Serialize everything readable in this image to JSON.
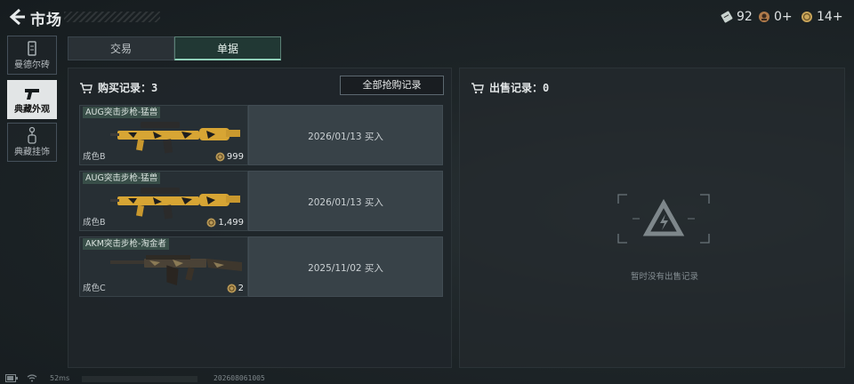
{
  "header": {
    "title": "市场",
    "currencies": [
      {
        "icon": "ticket-icon",
        "value": "92"
      },
      {
        "icon": "gold-token-icon",
        "value": "0+"
      },
      {
        "icon": "coin-icon",
        "value": "14+"
      }
    ]
  },
  "sidebar": {
    "items": [
      {
        "label": "曼德尔砖",
        "icon": "mandel-brick-icon",
        "active": false
      },
      {
        "label": "典藏外观",
        "icon": "pistol-icon",
        "active": true
      },
      {
        "label": "典藏挂饰",
        "icon": "charm-icon",
        "active": false
      }
    ]
  },
  "tabs": [
    {
      "label": "交易",
      "active": false
    },
    {
      "label": "单据",
      "active": true
    }
  ],
  "buy": {
    "title": "购买记录：",
    "count": "3",
    "all_button": "全部抢购记录",
    "records": [
      {
        "name": "AUG突击步枪-猛兽",
        "grade": "成色B",
        "price": "999",
        "record": "2026/01/13 买入",
        "weapon": "aug"
      },
      {
        "name": "AUG突击步枪-猛兽",
        "grade": "成色B",
        "price": "1,499",
        "record": "2026/01/13 买入",
        "weapon": "aug"
      },
      {
        "name": "AKM突击步枪-淘金者",
        "grade": "成色C",
        "price": "2",
        "record": "2025/11/02 买入",
        "weapon": "akm"
      }
    ]
  },
  "sell": {
    "title": "出售记录：",
    "count": "0",
    "empty_text": "暂时没有出售记录"
  },
  "status": {
    "ping": "52ms",
    "build": "202608061005"
  },
  "colors": {
    "accent": "#8fd0b8",
    "gold": "#d9a83a",
    "panel": "#20262a"
  }
}
